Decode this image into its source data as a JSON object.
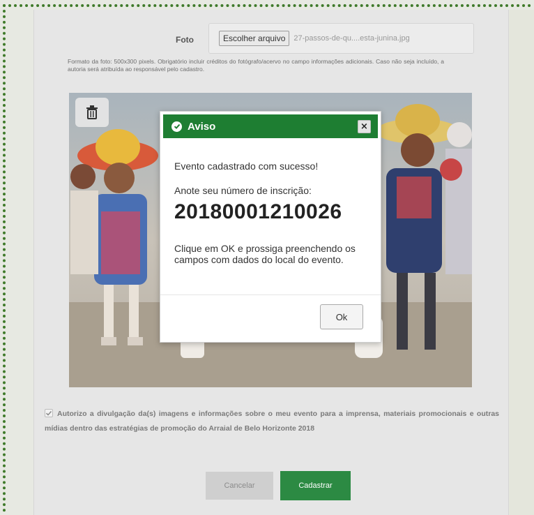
{
  "form": {
    "photo_label": "Foto",
    "file_button_label": "Escolher arquivo",
    "file_name": "27-passos-de-qu....esta-junina.jpg",
    "help_text": "Formato da foto: 500x300 pixels. Obrigatório incluir créditos do fotógrafo/acervo no campo informações adicionais. Caso não seja incluído, a autoria será atribuída ao responsável pelo cadastro.",
    "consent_checked": true,
    "consent_text": "Autorizo a divulgação da(s) imagens e informações sobre o meu evento para a imprensa, materiais promocionais e outras mídias dentro das estratégias de promoção do Arraial de Belo Horizonte 2018",
    "cancel_label": "Cancelar",
    "submit_label": "Cadastrar"
  },
  "modal": {
    "title": "Aviso",
    "close_symbol": "×",
    "message": "Evento cadastrado com sucesso!",
    "note": "Anote seu número de inscrição:",
    "registration_number": "20180001210026",
    "instruction": "Clique em OK e prossiga preenchendo os campos com dados do local do evento.",
    "ok_label": "Ok"
  },
  "icons": {
    "trash": "trash-icon",
    "check": "check-circle-icon",
    "close": "close-icon"
  },
  "colors": {
    "header_green": "#1e7e32",
    "submit_green": "#2c8a43",
    "frame_green": "#3f7a2a"
  }
}
